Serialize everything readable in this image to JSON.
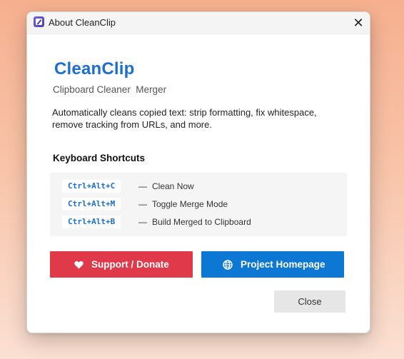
{
  "window": {
    "title": "About CleanClip",
    "close_symbol": "✕"
  },
  "app": {
    "name": "CleanClip",
    "subtitle": "Clipboard Cleaner  Merger",
    "description": "Automatically cleans copied text: strip formatting, fix whitespace, remove tracking from URLs, and more."
  },
  "shortcuts": {
    "title": "Keyboard Shortcuts",
    "dash": "—",
    "items": [
      {
        "keys": "Ctrl+Alt+C",
        "action": "Clean Now"
      },
      {
        "keys": "Ctrl+Alt+M",
        "action": "Toggle Merge Mode"
      },
      {
        "keys": "Ctrl+Alt+B",
        "action": "Build Merged to Clipboard"
      }
    ]
  },
  "buttons": {
    "donate": {
      "label": "Support / Donate",
      "icon": "heart-icon",
      "color": "#e03a4a"
    },
    "homepage": {
      "label": "Project Homepage",
      "icon": "globe-icon",
      "color": "#0d78d4"
    },
    "close": {
      "label": "Close"
    }
  },
  "colors": {
    "accent": "#1a6fd0"
  }
}
